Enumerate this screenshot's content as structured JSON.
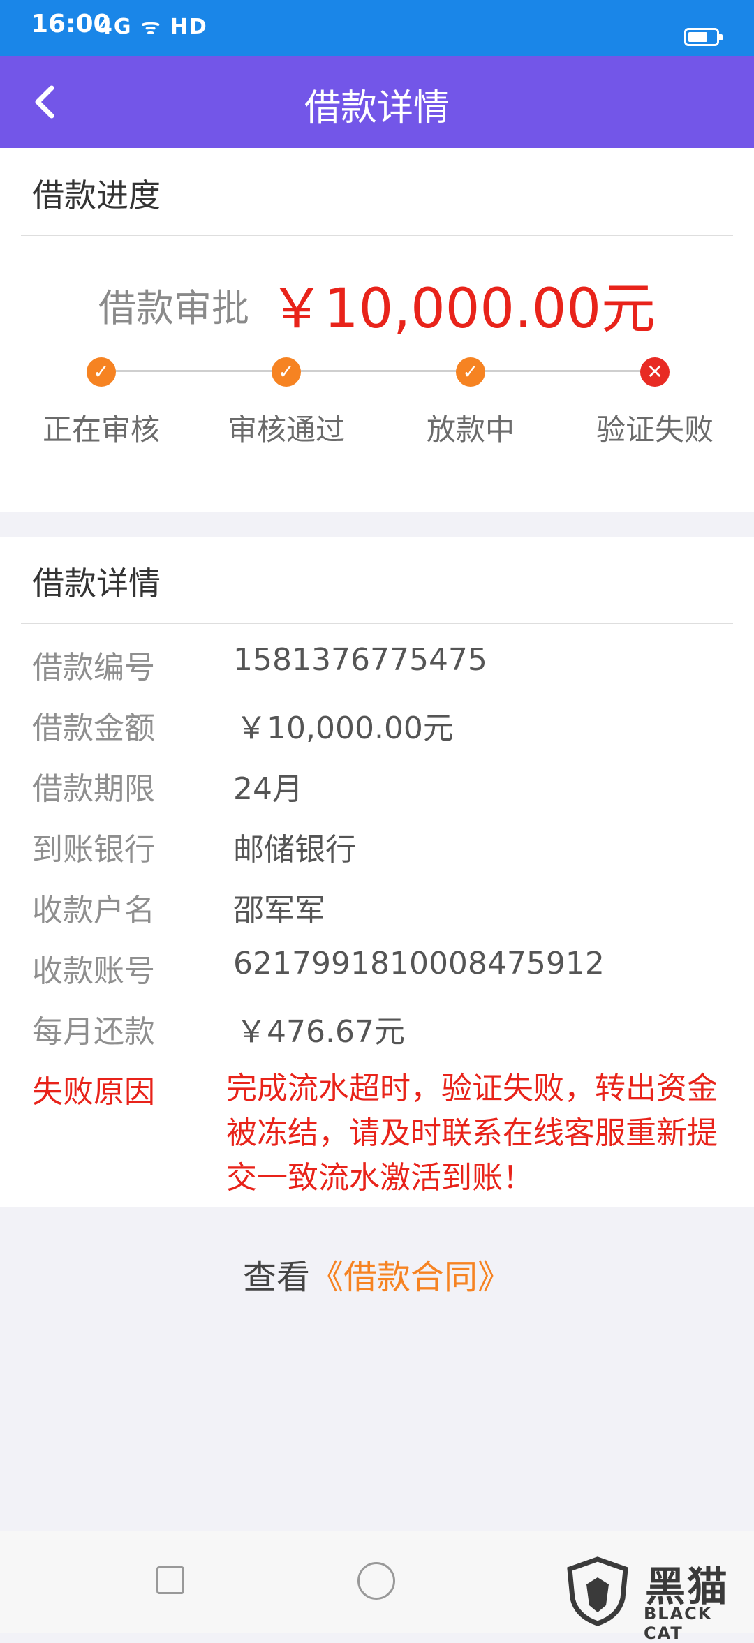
{
  "status_bar": {
    "time": "16:00",
    "icons_text": "4G ᯤ HD",
    "battery_level": 0.55
  },
  "header": {
    "title": "借款详情",
    "back_icon": "chevron-left-icon"
  },
  "progress_section": {
    "title": "借款进度",
    "amount_label": "借款审批",
    "amount_value": "￥10,000.00元",
    "steps": [
      {
        "label": "正在审核",
        "status": "done"
      },
      {
        "label": "审核通过",
        "status": "done"
      },
      {
        "label": "放款中",
        "status": "done"
      },
      {
        "label": "验证失败",
        "status": "failed"
      }
    ]
  },
  "details_section": {
    "title": "借款详情",
    "rows": [
      {
        "key": "借款编号",
        "value": "1581376775475"
      },
      {
        "key": "借款金额",
        "value": "￥10,000.00元"
      },
      {
        "key": "借款期限",
        "value": "24月"
      },
      {
        "key": "到账银行",
        "value": "邮储银行"
      },
      {
        "key": "收款户名",
        "value": "邵军军"
      },
      {
        "key": "收款账号",
        "value": "6217991810008475912"
      },
      {
        "key": "每月还款",
        "value": "￥476.67元"
      }
    ],
    "fail_reason": {
      "key": "失败原因",
      "lines": [
        "完成流水超时，验证失败，转出资金",
        "被冻结，请及时联系在线客服重新提",
        "交一致流水激活到账！"
      ]
    }
  },
  "contract": {
    "prefix": "查看",
    "link": "《借款合同》"
  },
  "watermark": {
    "cn": "黑猫",
    "en": "BLACK CAT"
  },
  "colors": {
    "status_bar": "#1a86e8",
    "nav_bar": "#7356e8",
    "amount_red": "#e8231a",
    "step_ok": "#f68322",
    "step_fail": "#e82b24",
    "link_orange": "#f68322"
  }
}
